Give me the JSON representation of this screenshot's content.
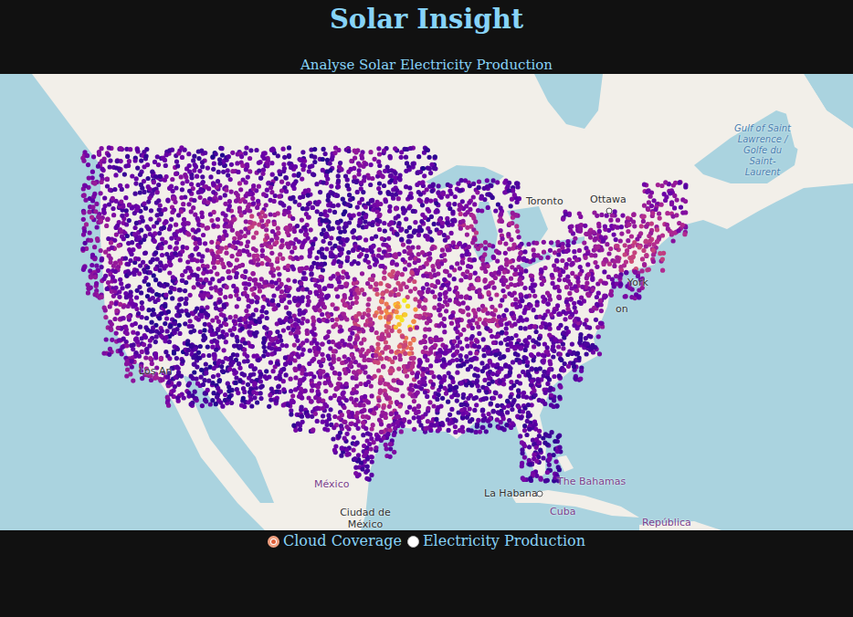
{
  "header": {
    "title": "Solar Insight",
    "subtitle": "Analyse Solar Electricity Production"
  },
  "map": {
    "labels": [
      {
        "text": "Ottawa",
        "kind": "city"
      },
      {
        "text": "Toronto",
        "kind": "city"
      },
      {
        "text": "York",
        "kind": "city"
      },
      {
        "text": "on",
        "kind": "city"
      },
      {
        "text": "Los An",
        "kind": "city"
      },
      {
        "text": "México",
        "kind": "country"
      },
      {
        "text": "Ciudad de México",
        "kind": "city"
      },
      {
        "text": "La Habana",
        "kind": "city"
      },
      {
        "text": "The Bahamas",
        "kind": "country"
      },
      {
        "text": "Cuba",
        "kind": "country"
      },
      {
        "text": "Gulf of Saint Lawrence / Golfe du Saint-Laurent",
        "kind": "water"
      },
      {
        "text": "República",
        "kind": "country"
      }
    ],
    "cloud_coverage": [
      [
        0.3,
        0.25,
        0.2,
        0.2,
        0.25,
        0.2,
        0.15,
        0.3,
        0.25,
        0.2,
        0.2,
        0.15,
        0.25,
        0.3,
        0.25,
        0.2,
        0.15,
        null,
        null,
        null,
        null,
        null,
        null,
        null,
        null,
        null,
        null,
        null,
        null
      ],
      [
        0.3,
        0.25,
        0.2,
        0.2,
        0.3,
        0.25,
        0.3,
        0.35,
        0.3,
        0.25,
        0.2,
        0.2,
        0.15,
        0.2,
        0.2,
        0.25,
        0.2,
        0.2,
        0.25,
        0.2,
        0.2,
        null,
        null,
        null,
        null,
        null,
        null,
        0.35,
        0.3
      ],
      [
        0.35,
        0.3,
        0.2,
        0.2,
        0.25,
        0.3,
        0.35,
        0.4,
        0.5,
        0.4,
        0.25,
        0.2,
        0.15,
        0.2,
        0.25,
        0.2,
        0.2,
        0.25,
        0.45,
        null,
        0.4,
        null,
        null,
        0.3,
        0.35,
        0.3,
        0.45,
        0.5,
        0.4
      ],
      [
        0.3,
        0.35,
        0.2,
        0.2,
        0.25,
        0.3,
        0.45,
        0.35,
        0.4,
        0.45,
        0.3,
        0.2,
        0.2,
        0.25,
        0.3,
        0.35,
        0.4,
        0.35,
        0.3,
        0.35,
        0.4,
        0.3,
        0.3,
        0.3,
        0.35,
        0.45,
        0.55,
        0.5,
        null
      ],
      [
        0.35,
        0.3,
        0.2,
        0.15,
        0.2,
        0.25,
        0.3,
        0.3,
        0.35,
        0.3,
        0.25,
        0.3,
        0.35,
        0.45,
        0.6,
        0.55,
        0.35,
        0.3,
        0.35,
        0.4,
        0.35,
        0.3,
        0.3,
        0.35,
        0.35,
        0.3,
        0.3,
        null,
        null
      ],
      [
        null,
        0.35,
        0.25,
        0.15,
        0.15,
        0.2,
        0.25,
        0.3,
        0.2,
        0.25,
        0.3,
        0.35,
        0.45,
        0.55,
        0.75,
        0.9,
        0.5,
        0.35,
        0.4,
        0.45,
        0.3,
        0.25,
        0.25,
        0.3,
        0.3,
        null,
        null,
        null,
        null
      ],
      [
        null,
        0.3,
        0.25,
        0.2,
        0.15,
        0.15,
        0.2,
        0.2,
        0.2,
        0.25,
        0.3,
        0.3,
        0.35,
        0.45,
        0.6,
        0.7,
        0.4,
        0.3,
        0.3,
        0.25,
        0.2,
        0.2,
        0.25,
        0.2,
        0.2,
        null,
        null,
        null,
        null
      ],
      [
        null,
        null,
        0.3,
        0.35,
        0.2,
        0.15,
        0.15,
        0.2,
        0.2,
        0.25,
        0.3,
        0.3,
        0.35,
        0.4,
        0.55,
        0.5,
        0.3,
        0.25,
        0.2,
        0.2,
        0.2,
        0.2,
        0.2,
        0.2,
        null,
        null,
        null,
        null,
        null
      ],
      [
        null,
        null,
        null,
        null,
        0.25,
        0.2,
        0.15,
        0.15,
        0.2,
        0.2,
        0.3,
        0.3,
        0.3,
        0.35,
        0.5,
        0.4,
        0.3,
        0.2,
        0.2,
        0.2,
        0.2,
        0.2,
        0.2,
        null,
        null,
        null,
        null,
        null,
        null
      ],
      [
        null,
        null,
        null,
        null,
        null,
        null,
        null,
        null,
        null,
        null,
        0.2,
        0.25,
        0.3,
        0.35,
        0.4,
        0.3,
        0.25,
        0.2,
        0.2,
        0.2,
        0.2,
        0.2,
        null,
        null,
        null,
        null,
        null,
        null,
        null
      ],
      [
        null,
        null,
        null,
        null,
        null,
        null,
        null,
        null,
        null,
        null,
        null,
        null,
        0.2,
        0.25,
        0.25,
        null,
        null,
        null,
        null,
        null,
        null,
        0.2,
        0.2,
        null,
        null,
        null,
        null,
        null,
        null
      ],
      [
        null,
        null,
        null,
        null,
        null,
        null,
        null,
        null,
        null,
        null,
        null,
        null,
        null,
        0.2,
        null,
        null,
        null,
        null,
        null,
        null,
        null,
        0.2,
        0.2,
        null,
        null,
        null,
        null,
        null,
        null
      ]
    ]
  },
  "radios": [
    {
      "label": "Cloud Coverage",
      "selected": true
    },
    {
      "label": "Electricity Production",
      "selected": false
    }
  ]
}
